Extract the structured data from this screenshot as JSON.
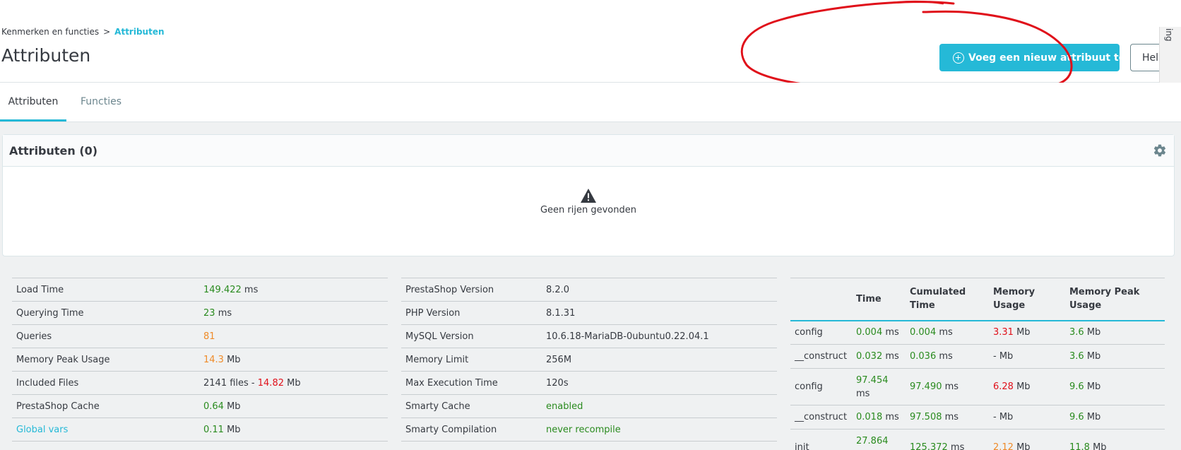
{
  "breadcrumb": {
    "parent": "Kenmerken en functies",
    "separator": ">",
    "current": "Attributen"
  },
  "page_title": "Attributen",
  "toolbar": {
    "add_label": "Voeg een nieuw attribuut toe",
    "help_label": "Help"
  },
  "side_tab": {
    "label": "ing"
  },
  "tabs": [
    {
      "label": "Attributen",
      "active": true
    },
    {
      "label": "Functies",
      "active": false
    }
  ],
  "panel": {
    "title": "Attributen (0)",
    "empty_message": "Geen rijen gevonden"
  },
  "profiler": {
    "summary": [
      {
        "label": "Load Time",
        "value": "149.422",
        "unit": "ms",
        "color": "#2a8b1f"
      },
      {
        "label": "Querying Time",
        "value": "23",
        "unit": "ms",
        "color": "#2a8b1f"
      },
      {
        "label": "Queries",
        "value": "81",
        "unit": "",
        "color": "#ef8b29"
      },
      {
        "label": "Memory Peak Usage",
        "value": "14.3",
        "unit": "Mb",
        "color": "#ef8b29"
      },
      {
        "label": "Included Files",
        "value": "2141 files -",
        "value2": "14.82",
        "unit": "Mb",
        "color2": "#e0101a"
      },
      {
        "label": "PrestaShop Cache",
        "value": "0.64",
        "unit": "Mb",
        "color": "#2a8b1f"
      },
      {
        "label": "Global vars",
        "value": "0.11",
        "unit": "Mb",
        "color": "#2a8b1f"
      }
    ],
    "environment": [
      {
        "label": "PrestaShop Version",
        "value": "8.2.0"
      },
      {
        "label": "PHP Version",
        "value": "8.1.31"
      },
      {
        "label": "MySQL Version",
        "value": "10.6.18-MariaDB-0ubuntu0.22.04.1"
      },
      {
        "label": "Memory Limit",
        "value": "256M"
      },
      {
        "label": "Max Execution Time",
        "value": "120s"
      },
      {
        "label": "Smarty Cache",
        "value": "enabled"
      },
      {
        "label": "Smarty Compilation",
        "value": "never recompile"
      }
    ],
    "steps_headers": [
      "",
      "Time",
      "Cumulated Time",
      "Memory Usage",
      "Memory Peak Usage"
    ],
    "steps": [
      {
        "name": "config",
        "time": "0.004",
        "cumulated": "0.004",
        "memory": "3.31",
        "memory_color": "#e0101a",
        "peak": "3.6"
      },
      {
        "name": "__construct",
        "time": "0.032",
        "cumulated": "0.036",
        "memory": "-",
        "memory_color": "#363a41",
        "peak": "3.6"
      },
      {
        "name": "config",
        "time": "97.454",
        "cumulated": "97.490",
        "memory": "6.28",
        "memory_color": "#e0101a",
        "peak": "9.6"
      },
      {
        "name": "__construct",
        "time": "0.018",
        "cumulated": "97.508",
        "memory": "-",
        "memory_color": "#363a41",
        "peak": "9.6"
      },
      {
        "name": "init",
        "time": "27.864",
        "cumulated": "125.372",
        "memory": "2.12",
        "memory_color": "#ef8b29",
        "peak": "11.8"
      }
    ],
    "units": {
      "ms": "ms",
      "mb": "Mb"
    }
  },
  "colors": {
    "accent": "#25b9d7",
    "annotation": "#e0101a",
    "good": "#2a8b1f",
    "warn": "#ef8b29",
    "bad": "#e0101a"
  }
}
